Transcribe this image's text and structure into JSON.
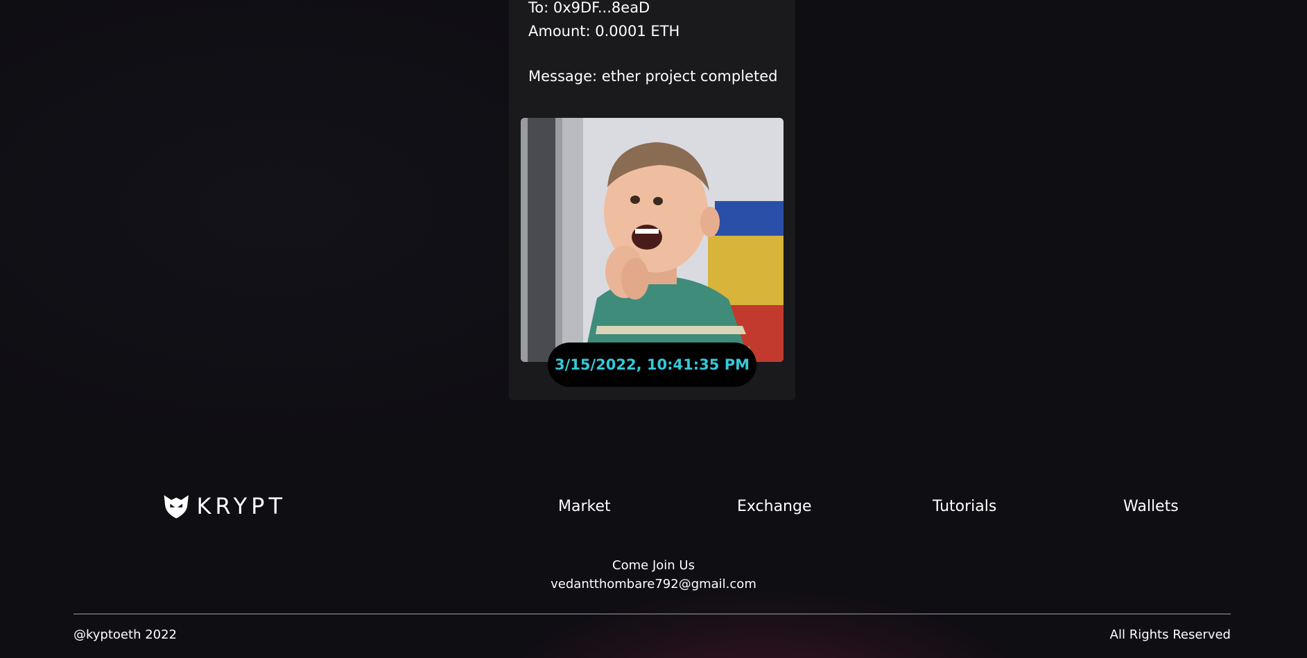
{
  "transaction": {
    "to": "To: 0x9DF...8eaD",
    "amount": "Amount: 0.0001 ETH",
    "message": "Message: ether project completed",
    "timestamp": "3/15/2022, 10:41:35 PM",
    "gif_subject": "excited-kid-gif"
  },
  "footer": {
    "logo_text": "KRYPT",
    "links": [
      {
        "label": "Market"
      },
      {
        "label": "Exchange"
      },
      {
        "label": "Tutorials"
      },
      {
        "label": "Wallets"
      }
    ],
    "join_title": "Come Join Us",
    "join_email": "vedantthombare792@gmail.com",
    "copyright": "@kyptoeth 2022",
    "rights": "All Rights Reserved"
  },
  "colors": {
    "background": "#0f0e13",
    "card": "#1a1a1d",
    "timestamp_text": "#37c7da",
    "timestamp_bg": "#000000"
  }
}
